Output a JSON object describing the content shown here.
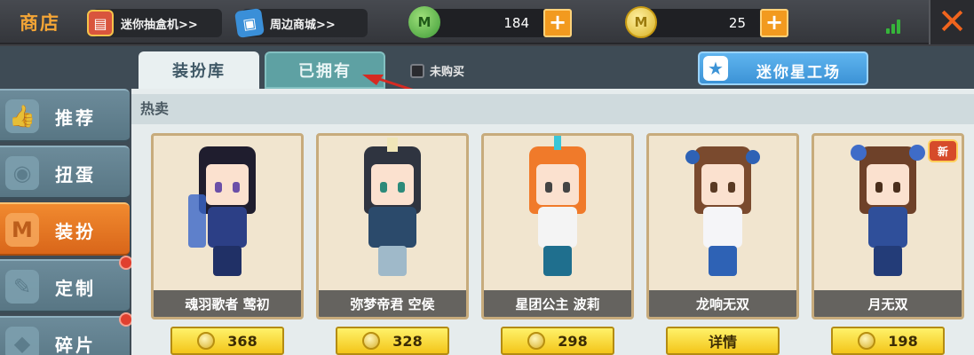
{
  "topbar": {
    "title": "商店",
    "gashapon_link": "迷你抽盒机>>",
    "merch_link": "周边商城>>",
    "gem_amount": "184",
    "coin_amount": "25",
    "add_symbol": "+",
    "close_symbol": "✕"
  },
  "sidebar": {
    "items": [
      {
        "label": "推荐",
        "icon": "thumbs-up-icon"
      },
      {
        "label": "扭蛋",
        "icon": "capsule-icon"
      },
      {
        "label": "装扮",
        "icon": "shirt-icon"
      },
      {
        "label": "定制",
        "icon": "pencil-icon"
      },
      {
        "label": "碎片",
        "icon": "fragment-icon"
      }
    ],
    "active_index": 2
  },
  "tabs": {
    "wardrobe": "装扮库",
    "owned": "已拥有",
    "unbought": "未购买",
    "studio": "迷你星工场"
  },
  "section": {
    "title": "热卖"
  },
  "items": [
    {
      "name": "魂羽歌者 莺初",
      "action": "368"
    },
    {
      "name": "弥梦帝君 空侯",
      "action": "328"
    },
    {
      "name": "星团公主 波莉",
      "action": "298"
    },
    {
      "name": "龙响无双",
      "action": "详情"
    },
    {
      "name": "月无双",
      "action": "198"
    }
  ],
  "colors": {
    "accent_orange": "#f18a2f",
    "price_yellow": "#f3c519",
    "owned_tab": "#5ea1a3",
    "studio_blue": "#3c93d6"
  }
}
